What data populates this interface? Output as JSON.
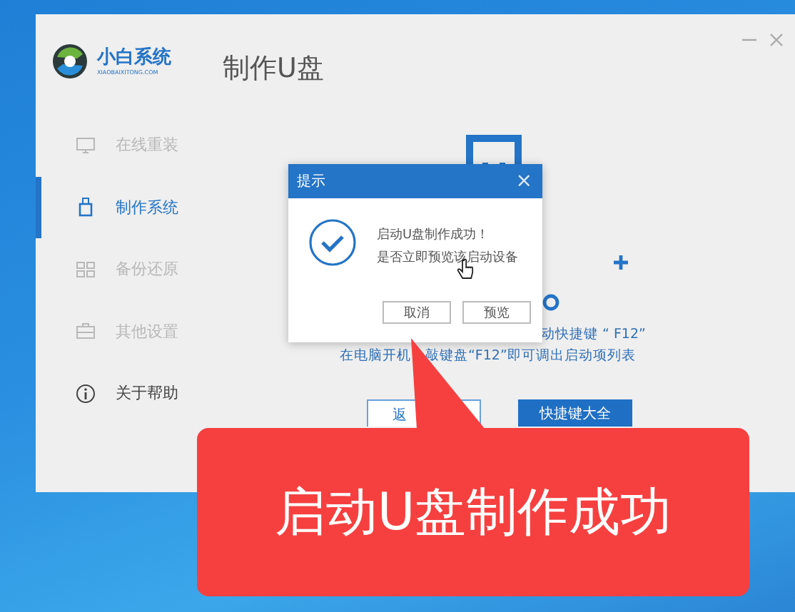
{
  "logo": {
    "name": "小白系统",
    "subtitle": "XIAOBAIXITONG.COM"
  },
  "page_title": "制作U盘",
  "sidebar": {
    "items": [
      {
        "label": "在线重装",
        "selected": false,
        "disabled": true
      },
      {
        "label": "制作系统",
        "selected": true,
        "disabled": false
      },
      {
        "label": "备份还原",
        "selected": false,
        "disabled": true
      },
      {
        "label": "其他设置",
        "selected": false,
        "disabled": true
      },
      {
        "label": "关于帮助",
        "selected": false,
        "disabled": false
      }
    ]
  },
  "content": {
    "hint_lines": [
      "动快捷键 “ F12”",
      "在电脑开机",
      "敲键盘“F12”即可调出启动项列表"
    ],
    "buttons": [
      {
        "label": "返",
        "kind": "outline"
      },
      {
        "label": "快捷键大全",
        "kind": "primary"
      }
    ]
  },
  "dialog": {
    "title": "提示",
    "close": "×",
    "message_lines": [
      "启动U盘制作成功！",
      "是否立即预览该启动设备"
    ],
    "buttons": [
      "取消",
      "预览"
    ]
  },
  "callout": {
    "text": "启动U盘制作成功"
  }
}
